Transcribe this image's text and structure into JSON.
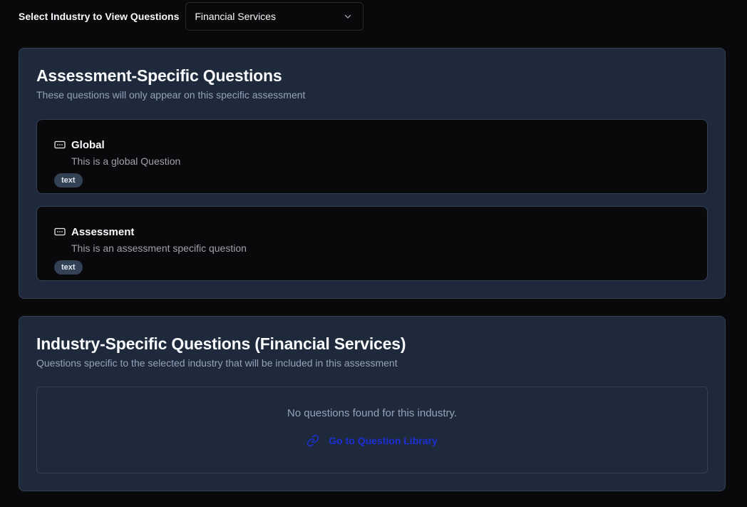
{
  "industry_filter": {
    "label": "Select Industry to View Questions",
    "selected": "Financial Services",
    "icon": "chevron-down-icon"
  },
  "assessment_section": {
    "title": "Assessment-Specific Questions",
    "description": "These questions will only appear on this specific assessment",
    "questions": [
      {
        "title": "Global",
        "text": "This is a global Question",
        "type": "text",
        "icon": "text-input-icon"
      },
      {
        "title": "Assessment",
        "text": "This is an assessment specific question",
        "type": "text",
        "icon": "text-input-icon"
      }
    ]
  },
  "industry_section": {
    "title": "Industry-Specific Questions (Financial Services)",
    "description": "Questions specific to the selected industry that will be included in this assessment",
    "empty_message": "No questions found for this industry.",
    "library_link": "Go to Question Library",
    "library_icon": "link-icon"
  },
  "colors": {
    "page_bg": "#09090b",
    "card_bg": "#1e293b",
    "border": "#334155",
    "link": "#1d2fd6",
    "muted": "#94a3b8"
  }
}
